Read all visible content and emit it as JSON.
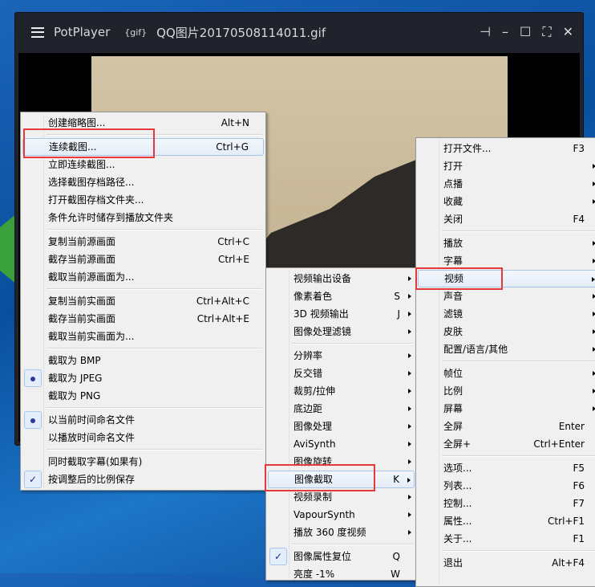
{
  "player": {
    "app": "PotPlayer",
    "format": "{gif}",
    "filename": "QQ图片20170508114011.gif"
  },
  "menu_capture": [
    {
      "label": "创建缩略图...",
      "shortcut": "Alt+N"
    },
    {
      "sep": true
    },
    {
      "label": "连续截图...",
      "shortcut": "Ctrl+G",
      "highlight": true
    },
    {
      "label": "立即连续截图..."
    },
    {
      "label": "选择截图存档路径..."
    },
    {
      "label": "打开截图存档文件夹..."
    },
    {
      "label": "条件允许时储存到播放文件夹"
    },
    {
      "sep": true
    },
    {
      "label": "复制当前源画面",
      "shortcut": "Ctrl+C"
    },
    {
      "label": "截存当前源画面",
      "shortcut": "Ctrl+E"
    },
    {
      "label": "截取当前源画面为..."
    },
    {
      "sep": true
    },
    {
      "label": "复制当前实画面",
      "shortcut": "Ctrl+Alt+C"
    },
    {
      "label": "截存当前实画面",
      "shortcut": "Ctrl+Alt+E"
    },
    {
      "label": "截取当前实画面为..."
    },
    {
      "sep": true
    },
    {
      "label": "截取为 BMP"
    },
    {
      "label": "截取为 JPEG",
      "mark": "radio"
    },
    {
      "label": "截取为 PNG"
    },
    {
      "sep": true
    },
    {
      "label": "以当前时间命名文件",
      "mark": "radio"
    },
    {
      "label": "以播放时间命名文件"
    },
    {
      "sep": true
    },
    {
      "label": "同时截取字幕(如果有)"
    },
    {
      "label": "按调整后的比例保存",
      "mark": "check"
    }
  ],
  "menu_video": [
    {
      "label": "视频输出设备",
      "sub": true
    },
    {
      "label": "像素着色",
      "shortcut": "S",
      "sub": true
    },
    {
      "label": "3D 视频输出",
      "shortcut": "J",
      "sub": true
    },
    {
      "label": "图像处理滤镜",
      "sub": true
    },
    {
      "sep": true
    },
    {
      "label": "分辨率",
      "sub": true
    },
    {
      "label": "反交错",
      "sub": true
    },
    {
      "label": "裁剪/拉伸",
      "sub": true
    },
    {
      "label": "底边距",
      "sub": true
    },
    {
      "label": "图像处理",
      "sub": true
    },
    {
      "label": "AviSynth",
      "sub": true
    },
    {
      "label": "图像旋转",
      "sub": true
    },
    {
      "label": "图像截取",
      "shortcut": "K",
      "sub": true,
      "highlight": true
    },
    {
      "label": "视频录制",
      "sub": true
    },
    {
      "label": "VapourSynth",
      "sub": true
    },
    {
      "label": "播放 360 度视频",
      "sub": true
    },
    {
      "sep": true
    },
    {
      "label": "图像属性复位",
      "shortcut": "Q",
      "mark": "check"
    },
    {
      "label": "亮度 -1%",
      "shortcut": "W"
    }
  ],
  "menu_main": [
    {
      "label": "打开文件...",
      "shortcut": "F3"
    },
    {
      "label": "打开",
      "sub": true
    },
    {
      "label": "点播",
      "sub": true
    },
    {
      "label": "收藏",
      "sub": true
    },
    {
      "label": "关闭",
      "shortcut": "F4"
    },
    {
      "sep": true
    },
    {
      "label": "播放",
      "sub": true
    },
    {
      "label": "字幕",
      "sub": true
    },
    {
      "label": "视频",
      "sub": true,
      "highlight": true
    },
    {
      "label": "声音",
      "sub": true
    },
    {
      "label": "滤镜",
      "sub": true
    },
    {
      "label": "皮肤",
      "sub": true
    },
    {
      "label": "配置/语言/其他",
      "sub": true
    },
    {
      "sep": true
    },
    {
      "label": "帧位",
      "sub": true
    },
    {
      "label": "比例",
      "sub": true
    },
    {
      "label": "屏幕",
      "sub": true
    },
    {
      "label": "全屏",
      "shortcut": "Enter"
    },
    {
      "label": "全屏+",
      "shortcut": "Ctrl+Enter"
    },
    {
      "sep": true
    },
    {
      "label": "选项...",
      "shortcut": "F5"
    },
    {
      "label": "列表...",
      "shortcut": "F6"
    },
    {
      "label": "控制...",
      "shortcut": "F7"
    },
    {
      "label": "属性...",
      "shortcut": "Ctrl+F1"
    },
    {
      "label": "关于...",
      "shortcut": "F1"
    },
    {
      "sep": true
    },
    {
      "label": "退出",
      "shortcut": "Alt+F4"
    }
  ]
}
